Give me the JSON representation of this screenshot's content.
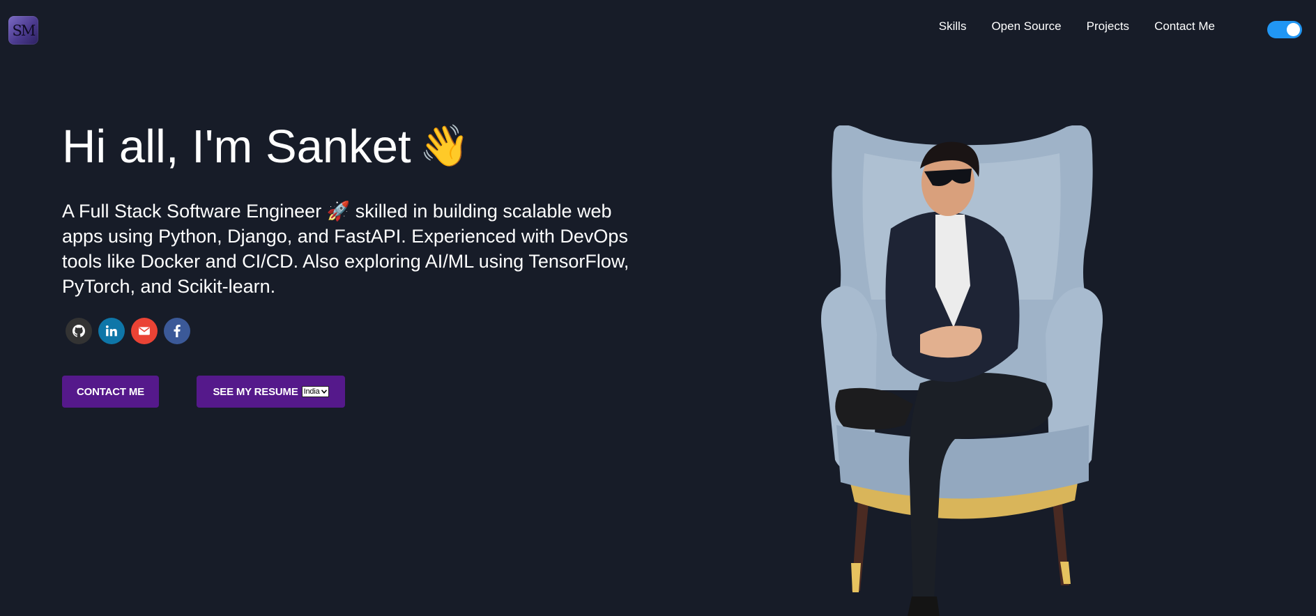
{
  "header": {
    "logo_text": "SM",
    "nav": [
      "Skills",
      "Open Source",
      "Projects",
      "Contact Me"
    ],
    "theme_toggle": "on"
  },
  "hero": {
    "title": "Hi all, I'm Sanket",
    "title_emoji": "👋",
    "subtitle": "A Full Stack Software Engineer 🚀 skilled in building scalable web apps using Python, Django, and FastAPI. Experienced with DevOps tools like Docker and CI/CD. Also exploring AI/ML using TensorFlow, PyTorch, and Scikit-learn.",
    "socials": [
      {
        "icon": "github-icon",
        "color": "#333333"
      },
      {
        "icon": "linkedin-icon",
        "color": "#0e76a8"
      },
      {
        "icon": "mail-icon",
        "color": "#ea4335"
      },
      {
        "icon": "facebook-icon",
        "color": "#3b5998"
      }
    ],
    "contact_button": "CONTACT ME",
    "resume_button": "SEE MY RESUME",
    "resume_region": "India"
  },
  "colors": {
    "background": "#171c28",
    "button": "#55198b",
    "toggle": "#2196f3"
  }
}
